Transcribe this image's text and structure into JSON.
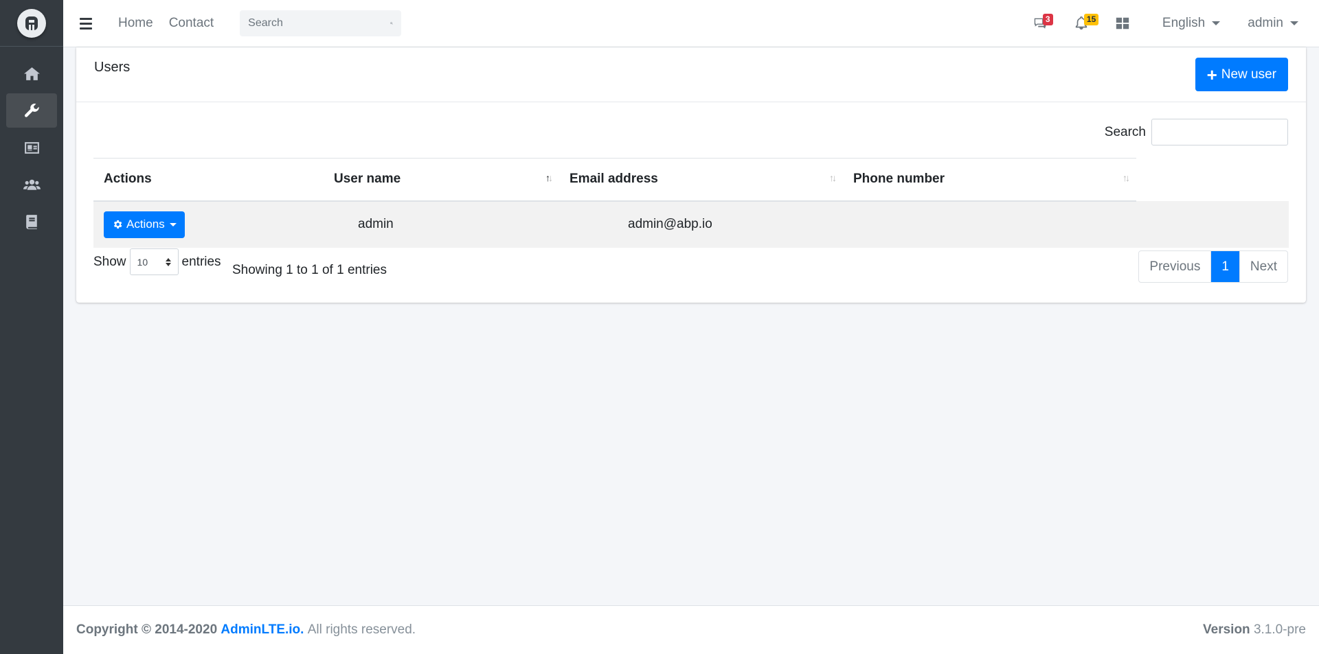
{
  "topbar": {
    "nav_links": [
      "Home",
      "Contact"
    ],
    "search_placeholder": "Search",
    "messages_badge": "3",
    "notifications_badge": "15",
    "language": "English",
    "user": "admin"
  },
  "sidebar": {
    "items": [
      {
        "icon": "home-icon",
        "active": false
      },
      {
        "icon": "wrench-icon",
        "active": true
      },
      {
        "icon": "id-card-icon",
        "active": false
      },
      {
        "icon": "users-icon",
        "active": false
      },
      {
        "icon": "book-icon",
        "active": false
      }
    ]
  },
  "card": {
    "title": "Users",
    "new_button": "New user",
    "search_label": "Search",
    "columns": [
      "Actions",
      "User name",
      "Email address",
      "Phone number"
    ],
    "rows": [
      {
        "action_label": "Actions",
        "user_name": "admin",
        "email": "admin@abp.io",
        "phone": ""
      }
    ],
    "length_prefix": "Show",
    "length_value": "10",
    "length_suffix": "entries",
    "info": "Showing 1 to 1 of 1 entries",
    "pager": {
      "previous": "Previous",
      "current": "1",
      "next": "Next"
    }
  },
  "footer": {
    "copyright_prefix": "Copyright © 2014-2020",
    "brand_link": "AdminLTE.io.",
    "rights": "All rights reserved.",
    "version_label": "Version",
    "version": "3.1.0-pre"
  },
  "colors": {
    "primary": "#007bff",
    "sidebar": "#343a40",
    "badge_danger": "#dc3545",
    "badge_warning": "#ffc107"
  }
}
